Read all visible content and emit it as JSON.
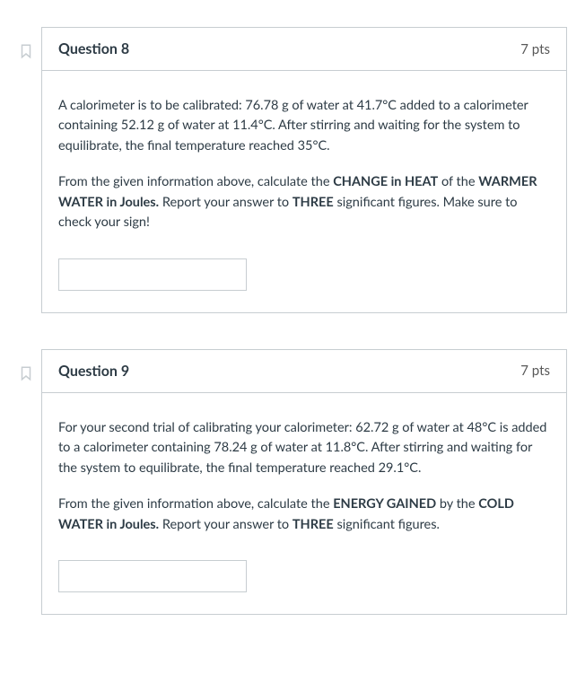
{
  "questions": [
    {
      "title": "Question 8",
      "pts": "7 pts",
      "p1_pre": "A calorimeter is to be calibrated: 76.78 g of water at 41.7°C added to a calorimeter containing 52.12 g of water at 11.4°C. After stirring and waiting for the system to equilibrate, the final temperature reached 35°C.",
      "p2_a": "From the given information above, calculate the ",
      "p2_b": "CHANGE in HEAT",
      "p2_c": " of the ",
      "p2_d": "WARMER WATER in Joules.",
      "p2_e": " Report your answer to ",
      "p2_f": "THREE",
      "p2_g": " significant figures. Make sure to check your sign!",
      "answer": ""
    },
    {
      "title": "Question 9",
      "pts": "7 pts",
      "p1_pre": "For your second trial of calibrating your calorimeter: 62.72 g of water at 48°C is added to a calorimeter containing 78.24 g of water at 11.8°C. After stirring and waiting for the system to equilibrate, the final temperature reached 29.1°C.",
      "p2_a": "From the given information above, calculate the ",
      "p2_b": "ENERGY GAINED",
      "p2_c": " by the ",
      "p2_d": "COLD WATER in Joules.",
      "p2_e": " Report your answer to ",
      "p2_f": "THREE",
      "p2_g": " significant figures.",
      "answer": ""
    }
  ]
}
